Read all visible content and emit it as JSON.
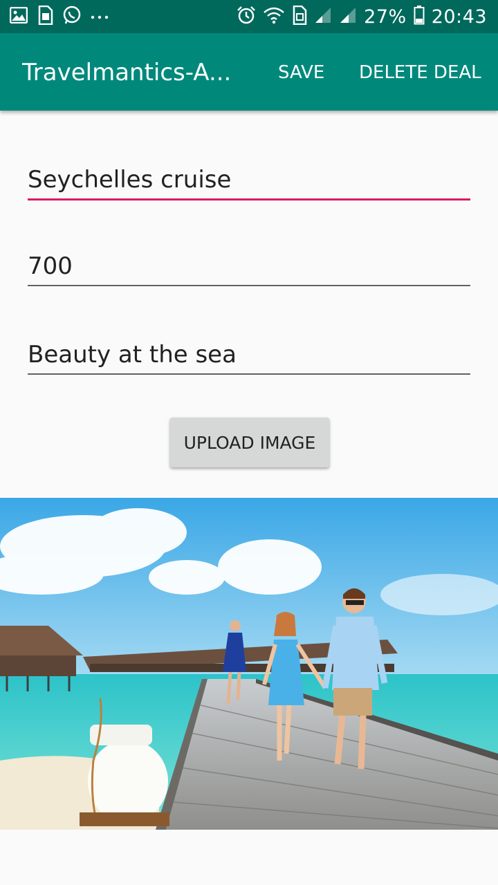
{
  "status_bar": {
    "battery": "27%",
    "time": "20:43",
    "left_icons": [
      "image-icon",
      "sim-card-icon",
      "whatsapp-icon",
      "more-icon"
    ],
    "right_icons": [
      "alarm-icon",
      "wifi-icon",
      "sim-icon",
      "signal-icon",
      "signal-icon",
      "battery-icon"
    ]
  },
  "app_bar": {
    "title": "Travelmantics-A...",
    "save_label": "SAVE",
    "delete_label": "DELETE DEAL",
    "background": "#00897b"
  },
  "form": {
    "title_value": "Seychelles cruise",
    "price_value": "700",
    "description_value": "Beauty at the sea",
    "upload_label": "UPLOAD IMAGE",
    "focus_color": "#d81b60"
  },
  "image": {
    "alt": "Seychelles cruise"
  }
}
